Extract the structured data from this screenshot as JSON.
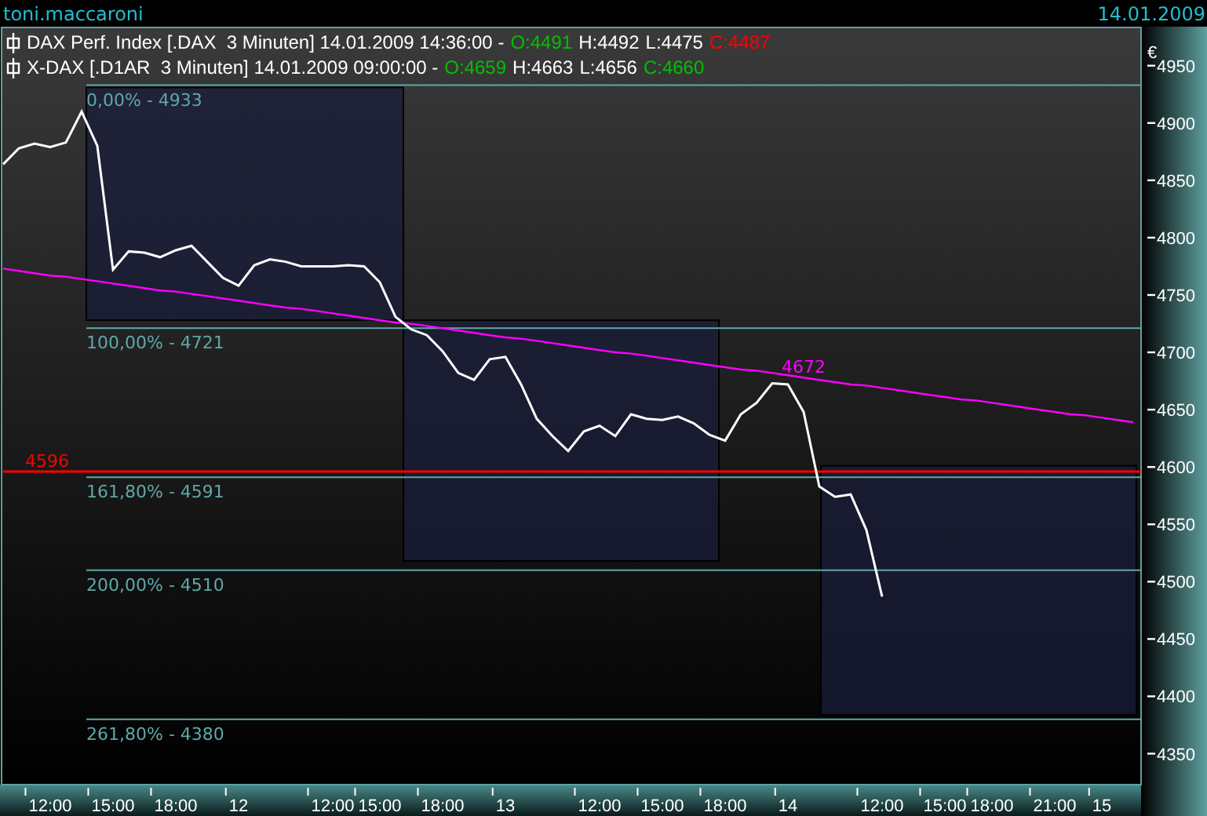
{
  "top_bar": {
    "user": "toni.maccaroni",
    "date": "14.01.2009"
  },
  "legend": [
    {
      "name": "DAX Perf. Index [.DAX  3 Minuten] 14.01.2009 14:36:00 -",
      "fields": [
        {
          "text": "O:4491",
          "color": "#00c000"
        },
        {
          "text": "H:4492",
          "color": "#ffffff"
        },
        {
          "text": "L:4475",
          "color": "#ffffff"
        },
        {
          "text": "C:4487",
          "color": "#ff0000"
        }
      ]
    },
    {
      "name": "X-DAX [.D1AR  3 Minuten] 14.01.2009 09:00:00 -",
      "fields": [
        {
          "text": "O:4659",
          "color": "#00c000"
        },
        {
          "text": "H:4663",
          "color": "#ffffff"
        },
        {
          "text": "L:4656",
          "color": "#ffffff"
        },
        {
          "text": "C:4660",
          "color": "#00c000"
        }
      ]
    }
  ],
  "axis_unit": "€",
  "chart_data": {
    "type": "line",
    "categories": [
      null,
      null,
      null,
      "12:00",
      null,
      null,
      null,
      "15:00",
      null,
      null,
      null,
      "18:00",
      null,
      null,
      null,
      "12",
      null,
      null,
      null,
      null,
      null,
      "12:00",
      null,
      null,
      "15:00",
      null,
      null,
      null,
      "18:00",
      null,
      null,
      null,
      "13",
      null,
      null,
      null,
      null,
      null,
      "12:00",
      null,
      null,
      null,
      "15:00",
      null,
      null,
      null,
      "18:00",
      null,
      null,
      null,
      "14",
      null,
      null,
      null,
      null,
      null,
      "12:00",
      null,
      null,
      null,
      "15:00",
      null,
      null,
      "18:00",
      null,
      null,
      null,
      "21:00",
      null,
      null,
      "15",
      null,
      null
    ],
    "series": [
      {
        "color": "#ff00ff",
        "values": [
          4773,
          4771,
          4769,
          4767,
          4766,
          4764,
          4762,
          4760,
          4758,
          4756,
          4754,
          4753,
          4751,
          4749,
          4747,
          4745,
          4743,
          4741,
          4739,
          4738,
          4736,
          4734,
          4732,
          4730,
          4728,
          4726,
          4725,
          4723,
          4721,
          4719,
          4717,
          4715,
          4713,
          4712,
          4710,
          4708,
          4706,
          4704,
          4702,
          4700,
          4699,
          4697,
          4695,
          4693,
          4691,
          4689,
          4687,
          4685,
          4684,
          4682,
          4680,
          4678,
          4676,
          4674,
          4672,
          4671,
          4669,
          4667,
          4665,
          4663,
          4661,
          4659,
          4658,
          4656,
          4654,
          4652,
          4650,
          4648,
          4646,
          4645,
          4643,
          4641,
          4639
        ]
      },
      {
        "color": "#ffffff",
        "values": [
          4864,
          4878,
          4882,
          4879,
          4883,
          4910,
          4880,
          4772,
          4788,
          4787,
          4783,
          4789,
          4793,
          4779,
          4765,
          4758,
          4776,
          4781,
          4779,
          4775,
          4775,
          4775,
          4776,
          4775,
          4761,
          4731,
          4720,
          4715,
          4701,
          4682,
          4676,
          4694,
          4696,
          4672,
          4642,
          4627,
          4614,
          4631,
          4636,
          4627,
          4646,
          4642,
          4641,
          4644,
          4638,
          4628,
          4623,
          4646,
          4656,
          4673,
          4672,
          4648,
          4583,
          4574,
          4576,
          4545,
          4487,
          null,
          null,
          null,
          null,
          null,
          null,
          null,
          null,
          null,
          null,
          null,
          null,
          null,
          null,
          null,
          null
        ]
      }
    ],
    "ylim": [
      4323,
      4984
    ],
    "yticks": [
      4350,
      4400,
      4450,
      4500,
      4550,
      4600,
      4650,
      4700,
      4750,
      4800,
      4850,
      4900,
      4950
    ],
    "ref_lines": [
      {
        "axis": "y",
        "value": 4933,
        "color": "#5fa8a8"
      },
      {
        "axis": "y",
        "value": 4721,
        "color": "#5fa8a8"
      },
      {
        "axis": "y",
        "value": 4591,
        "color": "#5fa8a8"
      },
      {
        "axis": "y",
        "value": 4510,
        "color": "#5fa8a8"
      },
      {
        "axis": "y",
        "value": 4380,
        "color": "#5fa8a8"
      },
      {
        "axis": "y",
        "value": 4596,
        "label": "4596",
        "color": "#ff0000"
      }
    ]
  },
  "overlays": [
    {
      "kind": "zone"
    },
    {
      "kind": "zone"
    },
    {
      "kind": "zone"
    },
    {
      "kind": "note",
      "label": "4672",
      "color": "#ff00ff"
    },
    {
      "kind": "level_label",
      "label": "0,00% - 4933"
    },
    {
      "kind": "level_label",
      "label": "100,00% - 4721"
    },
    {
      "kind": "level_label",
      "label": "161,80% - 4591"
    },
    {
      "kind": "level_label",
      "label": "200,00% - 4510"
    },
    {
      "kind": "level_label",
      "label": "261,80% - 4380"
    }
  ]
}
